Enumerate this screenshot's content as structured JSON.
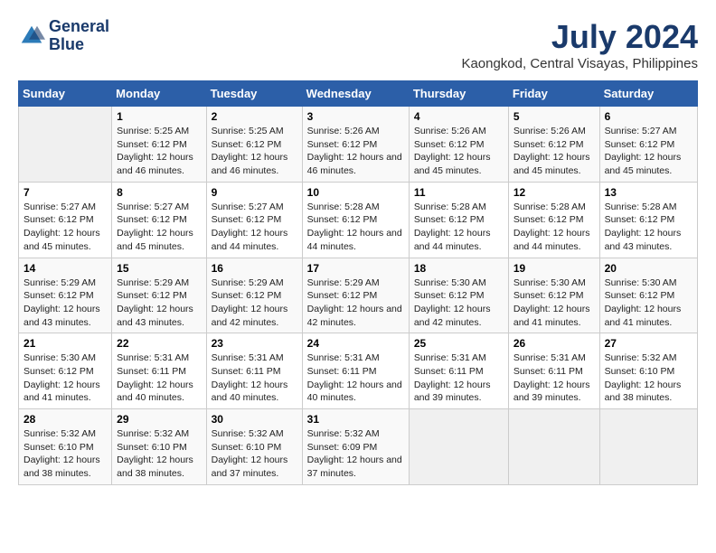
{
  "app": {
    "name_line1": "General",
    "name_line2": "Blue"
  },
  "title": "July 2024",
  "subtitle": "Kaongkod, Central Visayas, Philippines",
  "weekdays": [
    "Sunday",
    "Monday",
    "Tuesday",
    "Wednesday",
    "Thursday",
    "Friday",
    "Saturday"
  ],
  "weeks": [
    [
      {
        "day": "",
        "sunrise": "",
        "sunset": "",
        "daylight": ""
      },
      {
        "day": "1",
        "sunrise": "Sunrise: 5:25 AM",
        "sunset": "Sunset: 6:12 PM",
        "daylight": "Daylight: 12 hours and 46 minutes."
      },
      {
        "day": "2",
        "sunrise": "Sunrise: 5:25 AM",
        "sunset": "Sunset: 6:12 PM",
        "daylight": "Daylight: 12 hours and 46 minutes."
      },
      {
        "day": "3",
        "sunrise": "Sunrise: 5:26 AM",
        "sunset": "Sunset: 6:12 PM",
        "daylight": "Daylight: 12 hours and 46 minutes."
      },
      {
        "day": "4",
        "sunrise": "Sunrise: 5:26 AM",
        "sunset": "Sunset: 6:12 PM",
        "daylight": "Daylight: 12 hours and 45 minutes."
      },
      {
        "day": "5",
        "sunrise": "Sunrise: 5:26 AM",
        "sunset": "Sunset: 6:12 PM",
        "daylight": "Daylight: 12 hours and 45 minutes."
      },
      {
        "day": "6",
        "sunrise": "Sunrise: 5:27 AM",
        "sunset": "Sunset: 6:12 PM",
        "daylight": "Daylight: 12 hours and 45 minutes."
      }
    ],
    [
      {
        "day": "7",
        "sunrise": "Sunrise: 5:27 AM",
        "sunset": "Sunset: 6:12 PM",
        "daylight": "Daylight: 12 hours and 45 minutes."
      },
      {
        "day": "8",
        "sunrise": "Sunrise: 5:27 AM",
        "sunset": "Sunset: 6:12 PM",
        "daylight": "Daylight: 12 hours and 45 minutes."
      },
      {
        "day": "9",
        "sunrise": "Sunrise: 5:27 AM",
        "sunset": "Sunset: 6:12 PM",
        "daylight": "Daylight: 12 hours and 44 minutes."
      },
      {
        "day": "10",
        "sunrise": "Sunrise: 5:28 AM",
        "sunset": "Sunset: 6:12 PM",
        "daylight": "Daylight: 12 hours and 44 minutes."
      },
      {
        "day": "11",
        "sunrise": "Sunrise: 5:28 AM",
        "sunset": "Sunset: 6:12 PM",
        "daylight": "Daylight: 12 hours and 44 minutes."
      },
      {
        "day": "12",
        "sunrise": "Sunrise: 5:28 AM",
        "sunset": "Sunset: 6:12 PM",
        "daylight": "Daylight: 12 hours and 44 minutes."
      },
      {
        "day": "13",
        "sunrise": "Sunrise: 5:28 AM",
        "sunset": "Sunset: 6:12 PM",
        "daylight": "Daylight: 12 hours and 43 minutes."
      }
    ],
    [
      {
        "day": "14",
        "sunrise": "Sunrise: 5:29 AM",
        "sunset": "Sunset: 6:12 PM",
        "daylight": "Daylight: 12 hours and 43 minutes."
      },
      {
        "day": "15",
        "sunrise": "Sunrise: 5:29 AM",
        "sunset": "Sunset: 6:12 PM",
        "daylight": "Daylight: 12 hours and 43 minutes."
      },
      {
        "day": "16",
        "sunrise": "Sunrise: 5:29 AM",
        "sunset": "Sunset: 6:12 PM",
        "daylight": "Daylight: 12 hours and 42 minutes."
      },
      {
        "day": "17",
        "sunrise": "Sunrise: 5:29 AM",
        "sunset": "Sunset: 6:12 PM",
        "daylight": "Daylight: 12 hours and 42 minutes."
      },
      {
        "day": "18",
        "sunrise": "Sunrise: 5:30 AM",
        "sunset": "Sunset: 6:12 PM",
        "daylight": "Daylight: 12 hours and 42 minutes."
      },
      {
        "day": "19",
        "sunrise": "Sunrise: 5:30 AM",
        "sunset": "Sunset: 6:12 PM",
        "daylight": "Daylight: 12 hours and 41 minutes."
      },
      {
        "day": "20",
        "sunrise": "Sunrise: 5:30 AM",
        "sunset": "Sunset: 6:12 PM",
        "daylight": "Daylight: 12 hours and 41 minutes."
      }
    ],
    [
      {
        "day": "21",
        "sunrise": "Sunrise: 5:30 AM",
        "sunset": "Sunset: 6:12 PM",
        "daylight": "Daylight: 12 hours and 41 minutes."
      },
      {
        "day": "22",
        "sunrise": "Sunrise: 5:31 AM",
        "sunset": "Sunset: 6:11 PM",
        "daylight": "Daylight: 12 hours and 40 minutes."
      },
      {
        "day": "23",
        "sunrise": "Sunrise: 5:31 AM",
        "sunset": "Sunset: 6:11 PM",
        "daylight": "Daylight: 12 hours and 40 minutes."
      },
      {
        "day": "24",
        "sunrise": "Sunrise: 5:31 AM",
        "sunset": "Sunset: 6:11 PM",
        "daylight": "Daylight: 12 hours and 40 minutes."
      },
      {
        "day": "25",
        "sunrise": "Sunrise: 5:31 AM",
        "sunset": "Sunset: 6:11 PM",
        "daylight": "Daylight: 12 hours and 39 minutes."
      },
      {
        "day": "26",
        "sunrise": "Sunrise: 5:31 AM",
        "sunset": "Sunset: 6:11 PM",
        "daylight": "Daylight: 12 hours and 39 minutes."
      },
      {
        "day": "27",
        "sunrise": "Sunrise: 5:32 AM",
        "sunset": "Sunset: 6:10 PM",
        "daylight": "Daylight: 12 hours and 38 minutes."
      }
    ],
    [
      {
        "day": "28",
        "sunrise": "Sunrise: 5:32 AM",
        "sunset": "Sunset: 6:10 PM",
        "daylight": "Daylight: 12 hours and 38 minutes."
      },
      {
        "day": "29",
        "sunrise": "Sunrise: 5:32 AM",
        "sunset": "Sunset: 6:10 PM",
        "daylight": "Daylight: 12 hours and 38 minutes."
      },
      {
        "day": "30",
        "sunrise": "Sunrise: 5:32 AM",
        "sunset": "Sunset: 6:10 PM",
        "daylight": "Daylight: 12 hours and 37 minutes."
      },
      {
        "day": "31",
        "sunrise": "Sunrise: 5:32 AM",
        "sunset": "Sunset: 6:09 PM",
        "daylight": "Daylight: 12 hours and 37 minutes."
      },
      {
        "day": "",
        "sunrise": "",
        "sunset": "",
        "daylight": ""
      },
      {
        "day": "",
        "sunrise": "",
        "sunset": "",
        "daylight": ""
      },
      {
        "day": "",
        "sunrise": "",
        "sunset": "",
        "daylight": ""
      }
    ]
  ]
}
